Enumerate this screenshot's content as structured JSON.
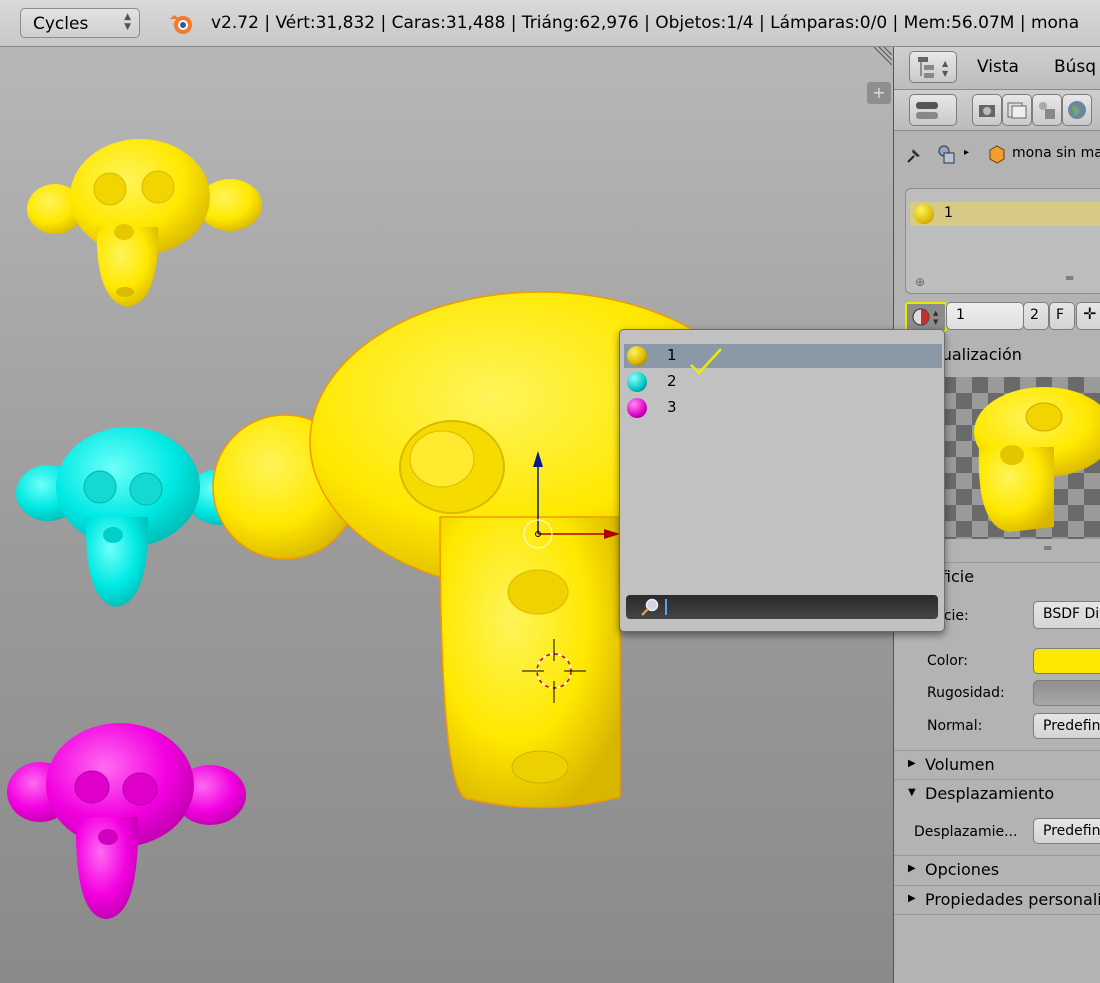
{
  "topbar": {
    "render_engine": "Cycles",
    "stats": "v2.72 | Vért:31,832 | Caras:31,488 | Triáng:62,976 | Objetos:1/4 | Lámparas:0/0 | Mem:56.07M | mona"
  },
  "viewport": {
    "colors": {
      "yellow": "#ffe800",
      "cyan": "#00e9e4",
      "magenta": "#f300e0"
    }
  },
  "material_popup": {
    "items": [
      {
        "label": "1",
        "color": "#f5d600",
        "selected": true
      },
      {
        "label": "2",
        "color": "#00c8c0",
        "selected": false
      },
      {
        "label": "3",
        "color": "#e000c8",
        "selected": false
      }
    ],
    "search_value": ""
  },
  "properties": {
    "header": {
      "menu_view": "Vista",
      "menu_search": "Búsq"
    },
    "context_object": "mona sin ma",
    "slots": [
      {
        "label": "1"
      }
    ],
    "material_name": "1",
    "users_count": "2",
    "fake_user": "F",
    "preview_title": "Previsualización",
    "surface_section": "Superficie",
    "surface_label": "Superficie:",
    "surface_value": "BSDF Di",
    "color_label": "Color:",
    "color_value": "#ffe800",
    "roughness_label": "Rugosidad:",
    "normal_label": "Normal:",
    "normal_value": "Predefin",
    "volume_section": "Volumen",
    "displacement_section": "Desplazamiento",
    "displacement_label": "Desplazamie...",
    "displacement_value": "Predefin",
    "options_section": "Opciones",
    "custom_props_section": "Propiedades personali"
  }
}
